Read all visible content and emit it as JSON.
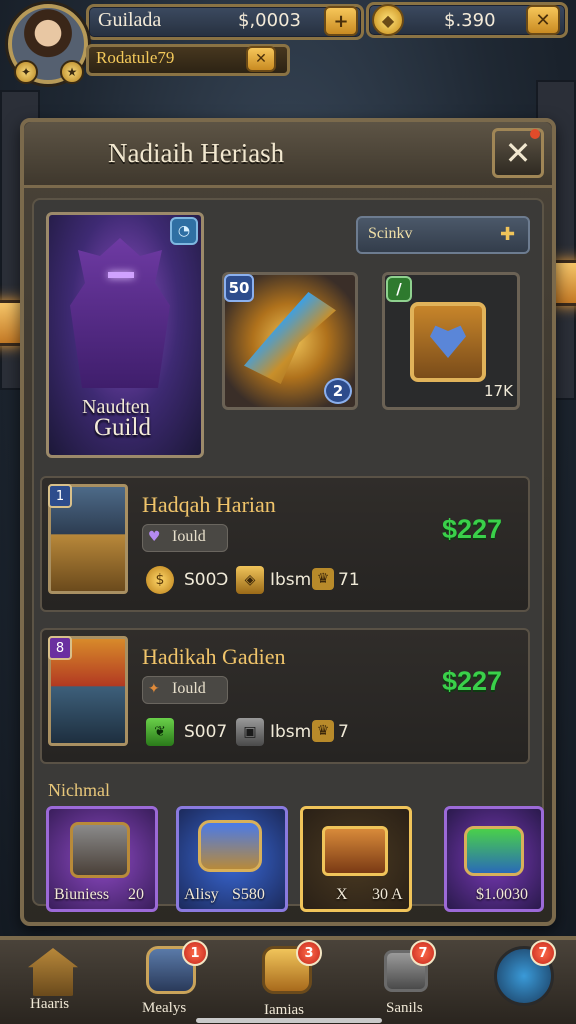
{
  "hud": {
    "player_name": "Guilada",
    "currency_primary": "$,0003",
    "currency_secondary": "$.390",
    "sub_label": "Rodatule79",
    "avatar_icon": "hero-avatar-icon",
    "gem_icon": "gem-icon"
  },
  "panel": {
    "title": "Nadiaih Heriash",
    "close_label": "✕"
  },
  "guild_card": {
    "line1": "Naudten",
    "line2": "Guild"
  },
  "filter": {
    "label": "Scinkv"
  },
  "tiles": {
    "tile1_badge": "50",
    "tile1_corner": "2",
    "tile2_badge": "/",
    "tile2_count": "17K"
  },
  "heroes": [
    {
      "name": "Hadqah Harian",
      "tag": "Iould",
      "stat1": "S00Ɔ",
      "stat2": "Ibsm",
      "stat3": "71",
      "price": "$227",
      "badge": "1"
    },
    {
      "name": "Hadikah Gadien",
      "tag": "Iould",
      "stat1": "S007",
      "stat2": "Ibsm",
      "stat3": "7",
      "price": "$227",
      "badge": "8"
    }
  ],
  "section": {
    "label": "Nichmal"
  },
  "bottom_items": [
    {
      "label": "Biuniess",
      "value": "20"
    },
    {
      "label": "Alisy",
      "value": "S580"
    },
    {
      "label": "X",
      "value": "30 A"
    },
    {
      "label": "",
      "value": "$1.0030"
    }
  ],
  "nav": [
    {
      "label": "Haaris",
      "badge": ""
    },
    {
      "label": "Mealys",
      "badge": "1"
    },
    {
      "label": "Iamias",
      "badge": "3"
    },
    {
      "label": "Sanils",
      "badge": "7"
    },
    {
      "label": "",
      "badge": "7"
    }
  ],
  "colors": {
    "price_green": "#3ad04a",
    "title_gold": "#f0c46a",
    "frame": "#7b6a4c"
  }
}
